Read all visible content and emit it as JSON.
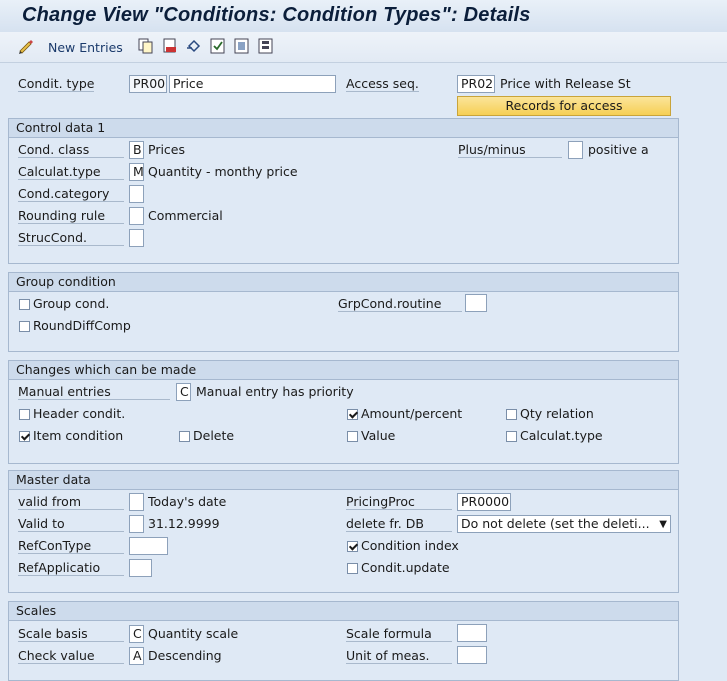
{
  "title": "Change View \"Conditions: Condition Types\": Details",
  "toolbar": {
    "new_entries": "New Entries",
    "icons": [
      "glasses-pencil-icon",
      "copy-icon",
      "delete-icon",
      "undo-icon",
      "select-all-icon",
      "deselect-all-icon",
      "block-select-icon"
    ]
  },
  "header": {
    "condit_type_label": "Condit. type",
    "condit_type_code": "PR00",
    "condit_type_name": "Price",
    "access_seq_label": "Access seq.",
    "access_seq_code": "PR02",
    "access_seq_name": "Price with Release St",
    "records_button": "Records for access"
  },
  "control": {
    "title": "Control data 1",
    "cond_class_label": "Cond. class",
    "cond_class_code": "B",
    "cond_class_text": "Prices",
    "calc_type_label": "Calculat.type",
    "calc_type_code": "M",
    "calc_type_text": "Quantity - monthy price",
    "cond_category_label": "Cond.category",
    "rounding_label": "Rounding rule",
    "rounding_text": "Commercial",
    "struc_label": "StrucCond.",
    "plusminus_label": "Plus/minus",
    "plusminus_text": "positive a"
  },
  "group": {
    "title": "Group condition",
    "group_cond": "Group cond.",
    "round_diff": "RoundDiffComp",
    "routine_label": "GrpCond.routine"
  },
  "changes": {
    "title": "Changes which can be made",
    "manual_label": "Manual entries",
    "manual_code": "C",
    "manual_text": "Manual entry has priority",
    "header_condit": "Header condit.",
    "item_condition": "Item condition",
    "delete": "Delete",
    "amount_percent": "Amount/percent",
    "value": "Value",
    "qty_relation": "Qty relation",
    "calculat_type": "Calculat.type"
  },
  "master": {
    "title": "Master data",
    "valid_from_label": "valid from",
    "valid_from_text": "Today's date",
    "valid_to_label": "Valid to",
    "valid_to_text": "31.12.9999",
    "refcontype_label": "RefConType",
    "refapp_label": "RefApplicatio",
    "pricing_label": "PricingProc",
    "pricing_value": "PR0000",
    "delete_db_label": "delete fr. DB",
    "delete_db_value": "Do not delete (set the deleti...",
    "condition_index": "Condition index",
    "condit_update": "Condit.update"
  },
  "scales": {
    "title": "Scales",
    "basis_label": "Scale basis",
    "basis_code": "C",
    "basis_text": "Quantity scale",
    "check_label": "Check value",
    "check_code": "A",
    "check_text": "Descending",
    "formula_label": "Scale formula",
    "unit_label": "Unit of meas."
  },
  "checks": {
    "group_cond": false,
    "round_diff": false,
    "header_condit": false,
    "item_condition": true,
    "delete": false,
    "amount_percent": true,
    "value": false,
    "qty_relation": false,
    "calculat_type": false,
    "condition_index": true,
    "condit_update": false
  },
  "colors": {
    "background": "#dfe9f5",
    "group_header": "#cddbec",
    "button_yellow": "#f6cf55",
    "title_text": "#0b1e3a"
  }
}
